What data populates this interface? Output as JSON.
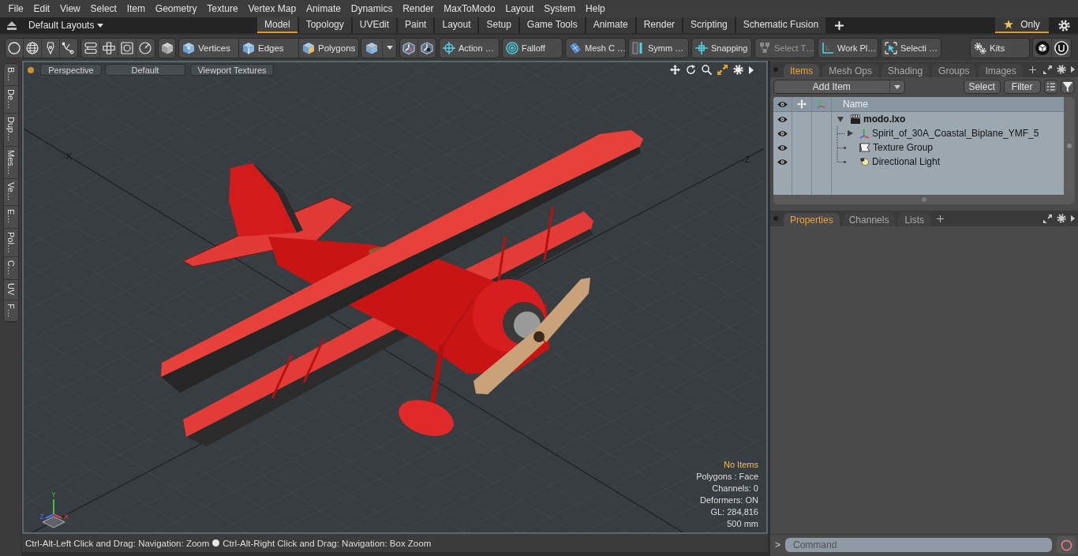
{
  "menu_bar": [
    "File",
    "Edit",
    "View",
    "Select",
    "Item",
    "Geometry",
    "Texture",
    "Vertex Map",
    "Animate",
    "Dynamics",
    "Render",
    "MaxToModo",
    "Layout",
    "System",
    "Help"
  ],
  "layout_bar": {
    "layouts_menu": "Default Layouts",
    "tabs": [
      {
        "label": "Model",
        "selected": true
      },
      {
        "label": "Topology",
        "selected": false
      },
      {
        "label": "UVEdit",
        "selected": false
      },
      {
        "label": "Paint",
        "selected": false
      },
      {
        "label": "Layout",
        "selected": false
      },
      {
        "label": "Setup",
        "selected": false
      },
      {
        "label": "Game Tools",
        "selected": false
      },
      {
        "label": "Animate",
        "selected": false
      },
      {
        "label": "Render",
        "selected": false
      },
      {
        "label": "Scripting",
        "selected": false
      },
      {
        "label": "Schematic Fusion",
        "selected": false
      }
    ],
    "only_toggle": {
      "label": "Only",
      "on": true
    }
  },
  "toolbar": {
    "selection_modes": [
      "Vertices",
      "Edges",
      "Polygons"
    ],
    "tools": [
      {
        "label": "Action …",
        "disabled": false
      },
      {
        "label": "Falloff",
        "disabled": false
      },
      {
        "label": "Mesh C …",
        "disabled": false
      },
      {
        "label": "Symm …",
        "disabled": false
      },
      {
        "label": "Snapping",
        "disabled": false
      },
      {
        "label": "Select T…",
        "disabled": true
      },
      {
        "label": "Work Pl…",
        "disabled": false
      },
      {
        "label": "Selecti …",
        "disabled": false
      }
    ],
    "kits": "Kits"
  },
  "side_tabs": [
    "B…",
    "De…",
    "Dup…",
    "Mes…",
    "Ve…",
    "E…",
    "Pol…",
    "C…",
    "UV",
    "F…"
  ],
  "viewport": {
    "view_buttons": [
      "Perspective",
      "Default",
      "Viewport Textures"
    ],
    "axis_labels": [
      "-X",
      "-Z"
    ],
    "gizmo_axes": [
      {
        "label": "Y",
        "color": "#3ec43e"
      },
      {
        "label": "Z",
        "color": "#4f6ff0"
      },
      {
        "label": "X",
        "color": "#e04444"
      }
    ],
    "info": [
      {
        "text": "No Items",
        "kind": "notice"
      },
      {
        "text": "Polygons : Face",
        "kind": "info"
      },
      {
        "text": "Channels: 0",
        "kind": "info"
      },
      {
        "text": "Deformers: ON",
        "kind": "info"
      },
      {
        "text": "GL: 284,816",
        "kind": "info"
      },
      {
        "text": "500 mm",
        "kind": "info"
      }
    ]
  },
  "status_bar": {
    "hints": [
      "Ctrl-Alt-Left Click and Drag: Navigation: Zoom",
      "Ctrl-Alt-Right Click and Drag: Navigation: Box Zoom"
    ]
  },
  "items_panel": {
    "tabs": [
      {
        "label": "Items",
        "selected": true
      },
      {
        "label": "Mesh Ops",
        "selected": false
      },
      {
        "label": "Shading",
        "selected": false
      },
      {
        "label": "Groups",
        "selected": false
      },
      {
        "label": "Images",
        "selected": false
      }
    ],
    "add_item": "Add Item",
    "buttons": [
      "Select",
      "Filter"
    ],
    "column": "Name",
    "tree": [
      {
        "name": "modo.lxo",
        "kind": "scene",
        "visible": true,
        "expanded": true,
        "children": [
          {
            "name": "Spirit_of_30A_Coastal_Biplane_YMF_5",
            "kind": "mesh",
            "visible": true,
            "expanded": false
          },
          {
            "name": "Texture Group",
            "kind": "texture_group",
            "visible": true
          },
          {
            "name": "Directional Light",
            "kind": "light",
            "visible": true
          }
        ]
      }
    ]
  },
  "properties_panel": {
    "tabs": [
      {
        "label": "Properties",
        "selected": true
      },
      {
        "label": "Channels",
        "selected": false
      },
      {
        "label": "Lists",
        "selected": false
      }
    ]
  },
  "command_bar": {
    "prompt": ">",
    "placeholder": "Command"
  }
}
